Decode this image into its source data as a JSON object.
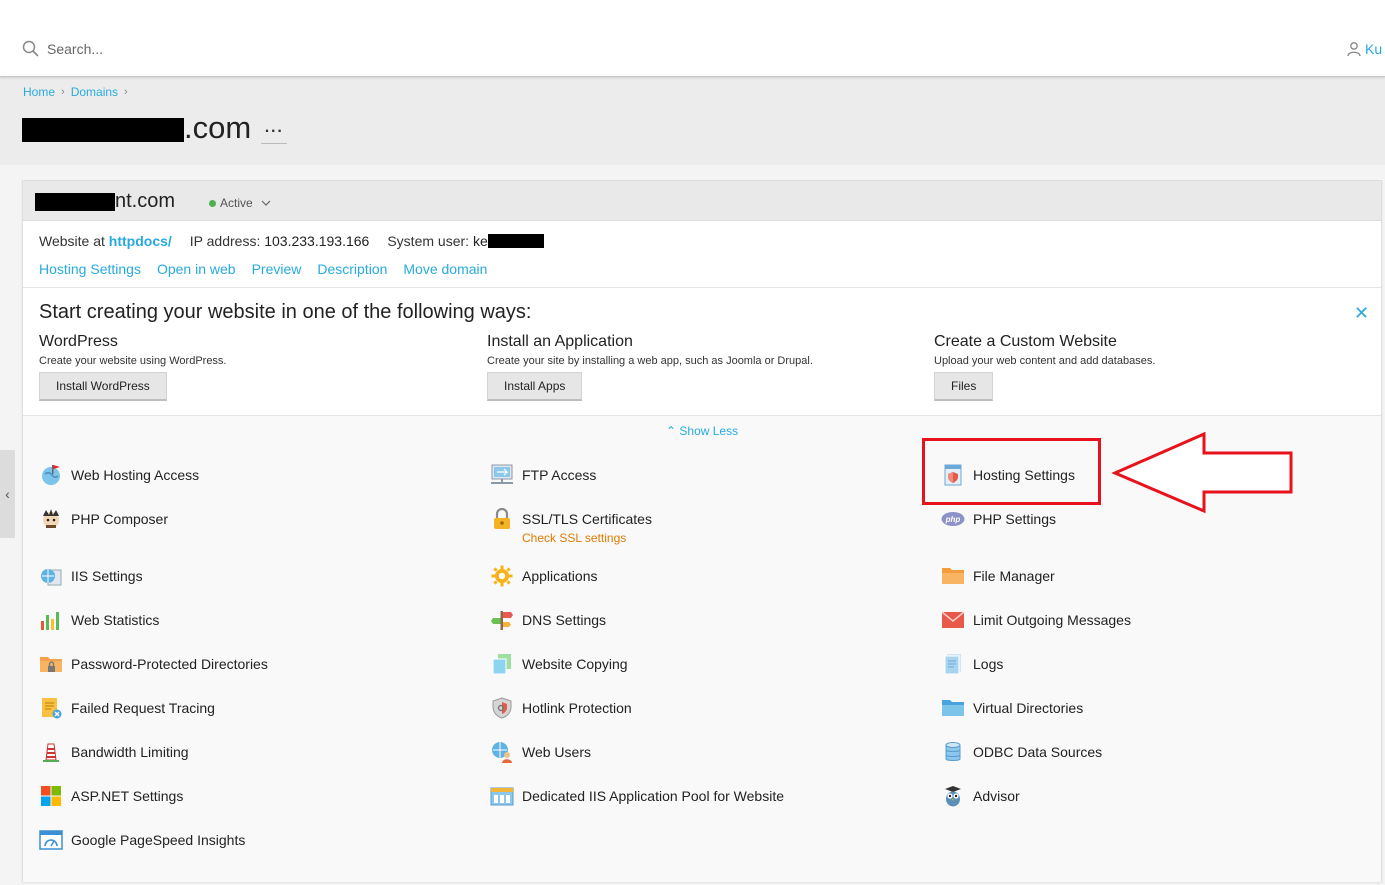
{
  "search": {
    "placeholder": "Search..."
  },
  "user": {
    "label": "Ku"
  },
  "breadcrumb": [
    {
      "label": "Home"
    },
    {
      "label": "Domains"
    }
  ],
  "page": {
    "title_suffix": ".com",
    "more": "···"
  },
  "domain": {
    "name_suffix": "nt.com",
    "status": "Active"
  },
  "info": {
    "website_at_label": "Website at",
    "website_at_value": "httpdocs/",
    "ip_label": "IP address:",
    "ip_value": "103.233.193.166",
    "user_label": "System user:",
    "user_value": "ke"
  },
  "links": [
    "Hosting Settings",
    "Open in web",
    "Preview",
    "Description",
    "Move domain"
  ],
  "start": {
    "title": "Start creating your website in one of the following ways:",
    "ways": [
      {
        "title": "WordPress",
        "desc": "Create your website using WordPress.",
        "button": "Install WordPress"
      },
      {
        "title": "Install an Application",
        "desc": "Create your site by installing a web app, such as Joomla or Drupal.",
        "button": "Install Apps"
      },
      {
        "title": "Create a Custom Website",
        "desc": "Upload your web content and add databases.",
        "button": "Files"
      }
    ]
  },
  "show_less": "Show Less",
  "tools": {
    "col1": [
      {
        "label": "Web Hosting Access",
        "icon": "globe-flag-icon"
      },
      {
        "label": "PHP Composer",
        "icon": "composer-icon"
      },
      {
        "label": "IIS Settings",
        "icon": "iis-globe-icon"
      },
      {
        "label": "Web Statistics",
        "icon": "bar-chart-icon"
      },
      {
        "label": "Password-Protected Directories",
        "icon": "locked-folder-icon"
      },
      {
        "label": "Failed Request Tracing",
        "icon": "trace-document-icon"
      },
      {
        "label": "Bandwidth Limiting",
        "icon": "lighthouse-icon"
      },
      {
        "label": "ASP.NET Settings",
        "icon": "windows-logo-icon"
      },
      {
        "label": "Google PageSpeed Insights",
        "icon": "speedometer-icon"
      }
    ],
    "col2": [
      {
        "label": "FTP Access",
        "icon": "ftp-monitor-icon"
      },
      {
        "label": "SSL/TLS Certificates",
        "icon": "padlock-icon",
        "sub": "Check SSL settings"
      },
      {
        "label": "Applications",
        "icon": "gear-icon"
      },
      {
        "label": "DNS Settings",
        "icon": "signpost-icon"
      },
      {
        "label": "Website Copying",
        "icon": "copy-pages-icon"
      },
      {
        "label": "Hotlink Protection",
        "icon": "shield-icon"
      },
      {
        "label": "Web Users",
        "icon": "globe-user-icon"
      },
      {
        "label": "Dedicated IIS Application Pool for Website",
        "icon": "app-pool-icon"
      }
    ],
    "col3": [
      {
        "label": "Hosting Settings",
        "icon": "hosting-settings-icon"
      },
      {
        "label": "PHP Settings",
        "icon": "php-icon"
      },
      {
        "label": "File Manager",
        "icon": "folder-icon"
      },
      {
        "label": "Limit Outgoing Messages",
        "icon": "envelope-icon"
      },
      {
        "label": "Logs",
        "icon": "log-document-icon"
      },
      {
        "label": "Virtual Directories",
        "icon": "blue-folder-icon"
      },
      {
        "label": "ODBC Data Sources",
        "icon": "database-icon"
      },
      {
        "label": "Advisor",
        "icon": "owl-icon"
      }
    ]
  },
  "colors": {
    "accent": "#28aade",
    "annotation": "#e8121c",
    "warning": "#e07b00"
  }
}
